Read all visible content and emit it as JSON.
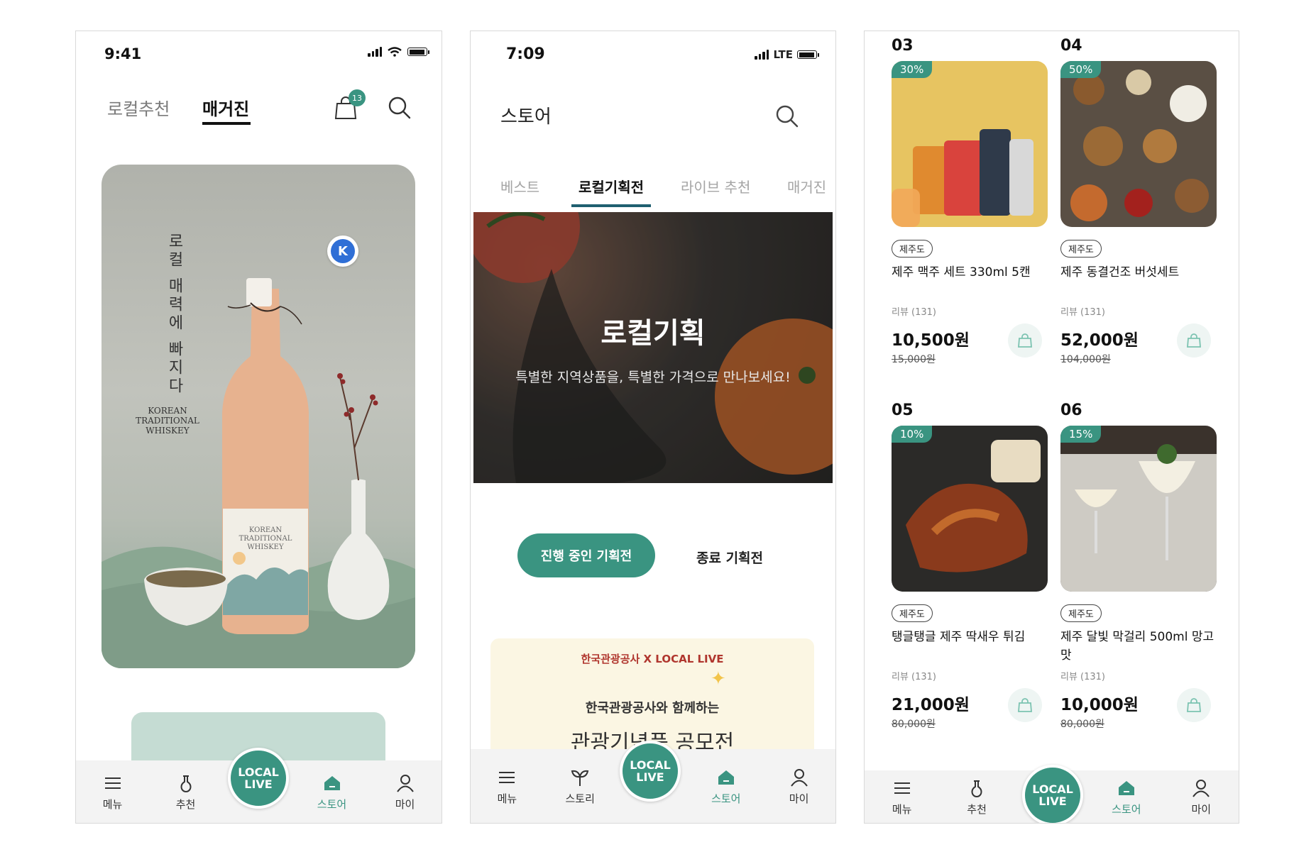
{
  "colors": {
    "accent": "#3a9481",
    "badge": "#3a9481",
    "k_badge": "#2f6fd6"
  },
  "phone1": {
    "status_time": "9:41",
    "tabs": [
      "로컬추천",
      "매거진"
    ],
    "cart_count": "13",
    "hero": {
      "vertical_title": "로컬 매력에 빠지다",
      "subtitle": "KOREAN\nTRADITIONAL\nWHISKEY",
      "label_text": "KOREAN\nTRADITIONAL\nWHISKEY",
      "avatar_letter": "K"
    },
    "tabbar": {
      "items": [
        "메뉴",
        "추천",
        "스토어",
        "마이"
      ],
      "logo": "LOCAL LIVE",
      "active": "스토어"
    }
  },
  "phone2": {
    "status_time": "7:09",
    "status_network": "LTE",
    "title": "스토어",
    "category_tabs": [
      "베스트",
      "로컬기획전",
      "라이브 추천",
      "매거진"
    ],
    "banner": {
      "title": "로컬기획",
      "subtitle": "특별한 지역상품을, 특별한 가격으로 만나보세요!"
    },
    "filters": {
      "active": "진행 중인 기획전",
      "inactive": "종료 기획전"
    },
    "promo": {
      "logos": "한국관광공사 X LOCAL LIVE",
      "line1": "한국관광공사와 함께하는",
      "line2": "관광기념품 공모전"
    },
    "tabbar": {
      "items": [
        "메뉴",
        "스토리",
        "스토어",
        "마이"
      ],
      "logo": "LOCAL LIVE",
      "active": "스토어"
    }
  },
  "phone3": {
    "products": [
      {
        "num": "03",
        "discount": "30%",
        "region": "제주도",
        "name": "제주 맥주 세트 330ml 5캔",
        "review": "리뷰 (131)",
        "price": "10,500원",
        "original": "15,000원"
      },
      {
        "num": "04",
        "discount": "50%",
        "region": "제주도",
        "name": "제주 동결건조 버섯세트",
        "review": "리뷰 (131)",
        "price": "52,000원",
        "original": "104,000원"
      },
      {
        "num": "05",
        "discount": "10%",
        "region": "제주도",
        "name": "탱글탱글 제주 딱새우 튀김",
        "review": "리뷰 (131)",
        "price": "21,000원",
        "original": "80,000원"
      },
      {
        "num": "06",
        "discount": "15%",
        "region": "제주도",
        "name": "제주 달빛 막걸리 500ml 망고맛",
        "review": "리뷰 (131)",
        "price": "10,000원",
        "original": "80,000원"
      }
    ],
    "tabbar": {
      "items": [
        "메뉴",
        "추천",
        "스토어",
        "마이"
      ],
      "logo": "LOCAL LIVE",
      "active": "스토어"
    }
  }
}
